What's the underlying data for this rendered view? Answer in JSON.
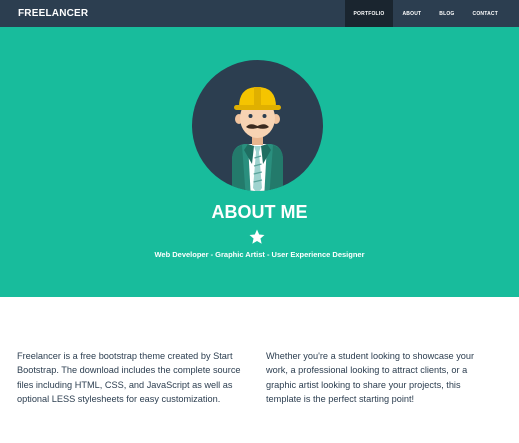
{
  "navbar": {
    "brand": "FREELANCER",
    "links": [
      {
        "label": "PORTFOLIO",
        "active": true
      },
      {
        "label": "ABOUT",
        "active": false
      },
      {
        "label": "BLOG",
        "active": false
      },
      {
        "label": "CONTACT",
        "active": false
      }
    ]
  },
  "hero": {
    "title": "ABOUT ME",
    "subtitle": "Web Developer - Graphic Artist - User Experience Designer",
    "icons": {
      "avatar": "freelancer-avatar-icon",
      "star": "star-icon"
    }
  },
  "about": {
    "left": "Freelancer is a free bootstrap theme created by Start Bootstrap. The download includes the complete source files including HTML, CSS, and JavaScript as well as optional LESS stylesheets for easy customization.",
    "right": "Whether you're a student looking to showcase your work, a professional looking to attract clients, or a graphic artist looking to share your projects, this template is the perfect starting point!"
  },
  "colors": {
    "navbar": "#2c3e50",
    "navbar_active": "#1a252f",
    "hero": "#18bc9c",
    "text": "#2c3e50"
  }
}
